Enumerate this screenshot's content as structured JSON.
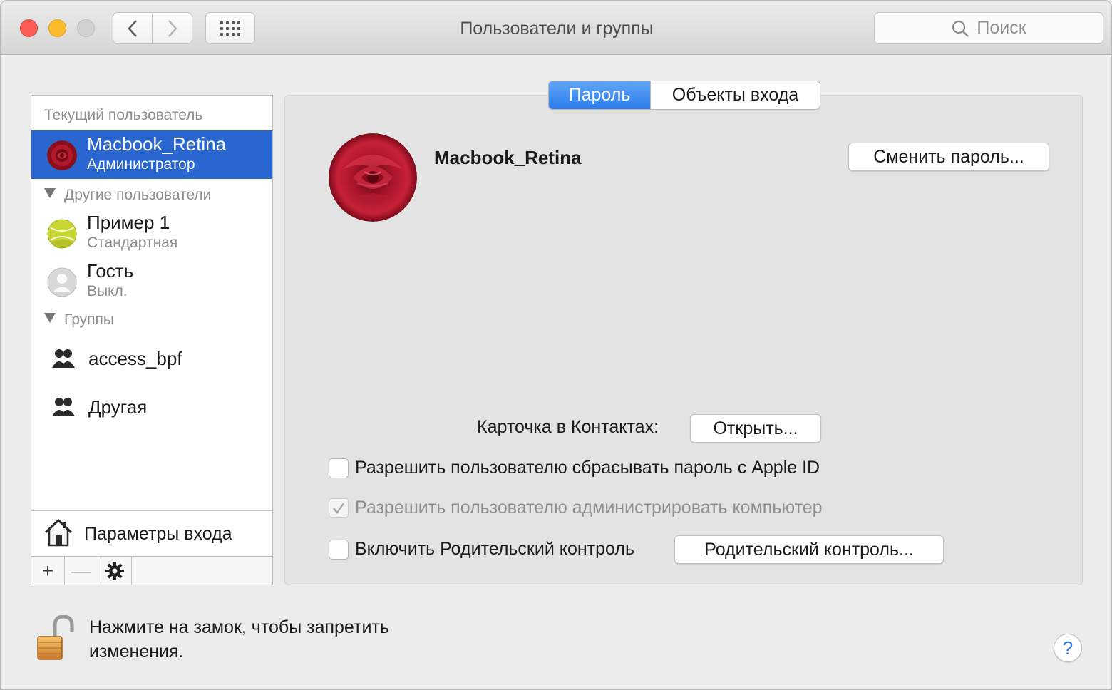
{
  "window": {
    "title": "Пользователи и группы",
    "search_placeholder": "Поиск"
  },
  "sidebar": {
    "current_user_header": "Текущий пользователь",
    "current_user": {
      "name": "Macbook_Retina",
      "role": "Администратор",
      "avatar": "red-rose"
    },
    "other_users_header": "Другие пользователи",
    "other_users": [
      {
        "name": "Пример 1",
        "role": "Стандартная",
        "avatar": "tennis-ball"
      },
      {
        "name": "Гость",
        "role": "Выкл.",
        "avatar": "guest-silhouette"
      }
    ],
    "groups_header": "Группы",
    "groups": [
      {
        "name": "access_bpf"
      },
      {
        "name": "Другая"
      }
    ],
    "login_options_label": "Параметры входа",
    "toolbar": {
      "add": "+",
      "remove": "—",
      "gear": "⚙"
    }
  },
  "tabs": [
    {
      "label": "Пароль",
      "active": true
    },
    {
      "label": "Объекты входа",
      "active": false
    }
  ],
  "detail": {
    "user_name": "Macbook_Retina",
    "change_password_button": "Сменить пароль...",
    "contacts_card_label": "Карточка в Контактах:",
    "open_button": "Открыть...",
    "checkboxes": [
      {
        "label": "Разрешить пользователю сбрасывать пароль с Apple ID",
        "checked": false,
        "enabled": true
      },
      {
        "label": "Разрешить пользователю администрировать компьютер",
        "checked": true,
        "enabled": false
      },
      {
        "label": "Включить Родительский контроль",
        "checked": false,
        "enabled": true
      }
    ],
    "parental_controls_button": "Родительский контроль..."
  },
  "footer": {
    "lock_text": "Нажмите на замок, чтобы запретить изменения.",
    "help": "?"
  },
  "colors": {
    "selection": "#2a66cf",
    "tab_active": "#2c7ded",
    "help_accent": "#2a72e4"
  }
}
